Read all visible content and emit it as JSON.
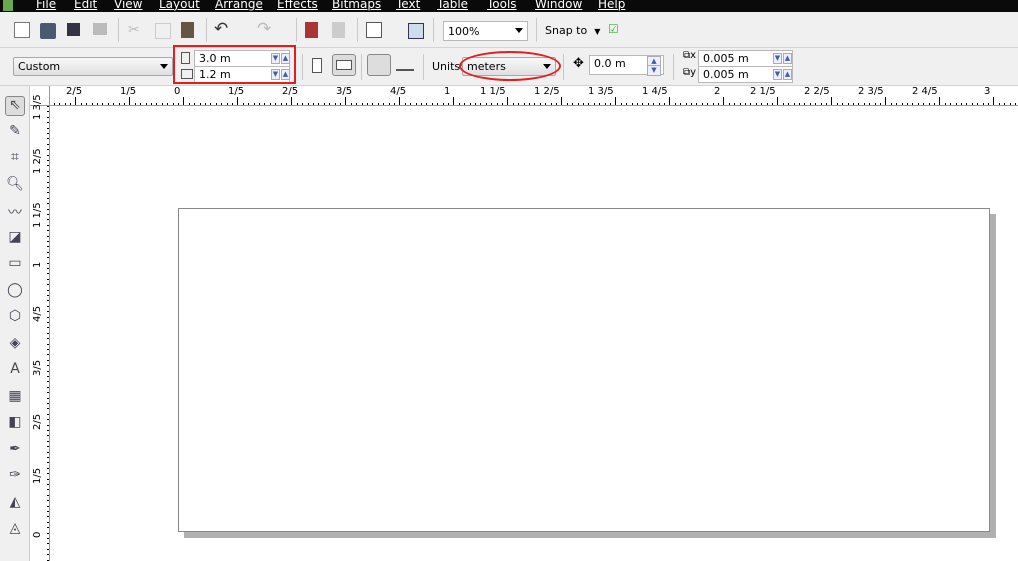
{
  "menu": [
    "File",
    "Edit",
    "View",
    "Layout",
    "Arrange",
    "Effects",
    "Bitmaps",
    "Text",
    "Table",
    "Tools",
    "Window",
    "Help"
  ],
  "toolbar": {
    "zoom": "100%",
    "snap_to": "Snap to"
  },
  "property_bar": {
    "page_size": "Custom",
    "width": "3.0 m",
    "height": "1.2 m",
    "units_label": "Units:",
    "units": "meters",
    "nudge": "0.0 m",
    "dup_x": "0.005 m",
    "dup_y": "0.005 m"
  },
  "ruler": {
    "h_labels": [
      "2/5",
      "1/5",
      "0",
      "1/5",
      "2/5",
      "3/5",
      "4/5",
      "1",
      "1 1/5",
      "1 2/5",
      "1 3/5",
      "1 4/5",
      "2",
      "2 1/5",
      "2 2/5",
      "2 3/5",
      "2 4/5",
      "3"
    ],
    "v_labels": [
      "1 3/5",
      "1 2/5",
      "1 1/5",
      "1",
      "4/5",
      "3/5",
      "2/5",
      "1/5",
      "0"
    ]
  },
  "tools": [
    "pick-tool",
    "shape-tool",
    "crop-tool",
    "zoom-tool",
    "freehand-tool",
    "smart-fill-tool",
    "rectangle-tool",
    "ellipse-tool",
    "polygon-tool",
    "basic-shapes-tool",
    "text-tool",
    "table-tool",
    "interactive-blend-tool",
    "eyedropper-tool",
    "outline-tool",
    "fill-tool",
    "interactive-fill-tool"
  ],
  "colors": {
    "highlight": "#e02020",
    "menubar": "#0a0a0a"
  }
}
